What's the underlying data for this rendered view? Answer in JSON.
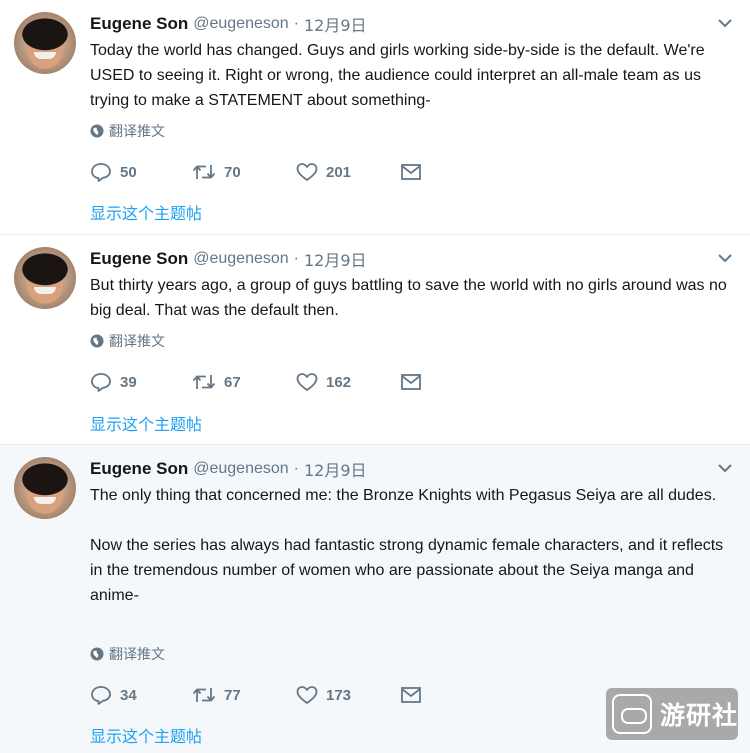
{
  "tweets": [
    {
      "author_name": "Eugene Son",
      "handle": "@eugeneson",
      "separator": "·",
      "date": "12月9日",
      "paragraphs": [
        "Today the world has changed. Guys and girls working side-by-side is the default. We're USED to seeing it. Right or wrong, the audience could interpret an all-male team as us trying to make a STATEMENT about something-"
      ],
      "translate_label": "翻译推文",
      "replies": "50",
      "retweets": "70",
      "likes": "201",
      "show_thread_label": "显示这个主题帖"
    },
    {
      "author_name": "Eugene Son",
      "handle": "@eugeneson",
      "separator": "·",
      "date": "12月9日",
      "paragraphs": [
        "But thirty years ago, a group of guys battling to save the world with no girls around was no big deal. That was the default then."
      ],
      "translate_label": "翻译推文",
      "replies": "39",
      "retweets": "67",
      "likes": "162",
      "show_thread_label": "显示这个主题帖"
    },
    {
      "author_name": "Eugene Son",
      "handle": "@eugeneson",
      "separator": "·",
      "date": "12月9日",
      "paragraphs": [
        "The only thing that concerned me: the Bronze Knights with Pegasus Seiya are all dudes.",
        "Now the series has always had fantastic strong dynamic female characters, and it reflects in the tremendous number of women who are passionate about the Seiya manga and anime-"
      ],
      "translate_label": "翻译推文",
      "replies": "34",
      "retweets": "77",
      "likes": "173",
      "show_thread_label": "显示这个主题帖"
    }
  ],
  "watermark_text": "游研社",
  "colors": {
    "text": "#14171a",
    "muted": "#657786",
    "link": "#1da1f2",
    "divider": "#e6ecf0",
    "highlight_bg": "#f5f8fa"
  },
  "icons": {
    "reply": "reply-icon",
    "retweet": "retweet-icon",
    "like": "heart-icon",
    "dm": "envelope-icon",
    "translate": "globe-icon",
    "caret": "chevron-down-icon"
  }
}
